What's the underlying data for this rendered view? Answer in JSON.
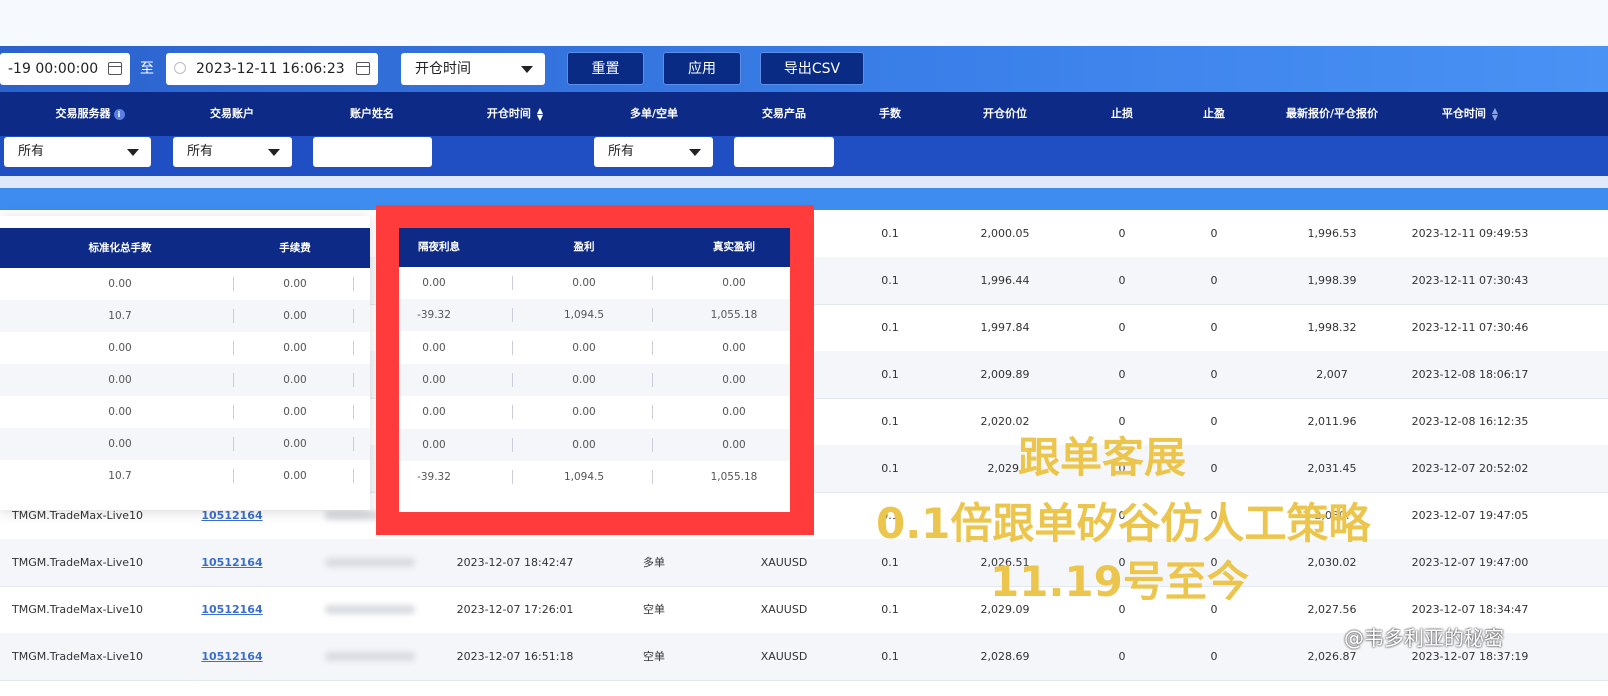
{
  "filters": {
    "start_datetime": "-19 00:00:00",
    "to_label": "至",
    "end_datetime": "2023-12-11 16:06:23",
    "time_type_select": "开仓时间",
    "reset_button": "重置",
    "apply_button": "应用",
    "export_button": "导出CSV"
  },
  "columns": {
    "server": "交易服务器",
    "account": "交易账户",
    "account_name": "账户姓名",
    "open_time": "开仓时间",
    "direction": "多单/空单",
    "product": "交易产品",
    "lots": "手数",
    "open_price": "开仓价位",
    "stop_loss": "止损",
    "take_profit": "止盈",
    "latest_price": "最新报价/平仓报价",
    "close_time": "平仓时间"
  },
  "column_filters": {
    "server": "所有",
    "account": "所有",
    "direction": "所有"
  },
  "rows": [
    {
      "server": "",
      "account": "",
      "open_time": "",
      "direction": "",
      "product": "",
      "lots": "0.1",
      "open_price": "2,000.05",
      "sl": "0",
      "tp": "0",
      "latest": "1,996.53",
      "close_time": "2023-12-11 09:49:53"
    },
    {
      "server": "",
      "account": "",
      "open_time": "",
      "direction": "",
      "product": "",
      "lots": "0.1",
      "open_price": "1,996.44",
      "sl": "0",
      "tp": "0",
      "latest": "1,998.39",
      "close_time": "2023-12-11 07:30:43"
    },
    {
      "server": "",
      "account": "",
      "open_time": "",
      "direction": "",
      "product": "",
      "lots": "0.1",
      "open_price": "1,997.84",
      "sl": "0",
      "tp": "0",
      "latest": "1,998.32",
      "close_time": "2023-12-11 07:30:46"
    },
    {
      "server": "",
      "account": "",
      "open_time": "",
      "direction": "",
      "product": "",
      "lots": "0.1",
      "open_price": "2,009.89",
      "sl": "0",
      "tp": "0",
      "latest": "2,007",
      "close_time": "2023-12-08 18:06:17"
    },
    {
      "server": "",
      "account": "",
      "open_time": "",
      "direction": "",
      "product": "",
      "lots": "0.1",
      "open_price": "2,020.02",
      "sl": "0",
      "tp": "0",
      "latest": "2,011.96",
      "close_time": "2023-12-08 16:12:35"
    },
    {
      "server": "",
      "account": "",
      "open_time": "",
      "direction": "",
      "product": "",
      "lots": "0.1",
      "open_price": "2,029.",
      "sl": "0",
      "tp": "0",
      "latest": "2,031.45",
      "close_time": "2023-12-07 20:52:02"
    },
    {
      "server": "TMGM.TradeMax-Live10",
      "account": "10512164",
      "open_time": "",
      "direction": "",
      "product": "",
      "lots": "0.1",
      "open_price": "",
      "sl": "0",
      "tp": "0",
      "latest": "2,030.",
      "close_time": "2023-12-07 19:47:05"
    },
    {
      "server": "TMGM.TradeMax-Live10",
      "account": "10512164",
      "open_time": "2023-12-07 18:42:47",
      "direction": "多单",
      "product": "XAUUSD",
      "lots": "0.1",
      "open_price": "2,026.51",
      "sl": "0",
      "tp": "0",
      "latest": "2,030.02",
      "close_time": "2023-12-07 19:47:00"
    },
    {
      "server": "TMGM.TradeMax-Live10",
      "account": "10512164",
      "open_time": "2023-12-07 17:26:01",
      "direction": "空单",
      "product": "XAUUSD",
      "lots": "0.1",
      "open_price": "2,029.09",
      "sl": "0",
      "tp": "0",
      "latest": "2,027.56",
      "close_time": "2023-12-07 18:34:47"
    },
    {
      "server": "TMGM.TradeMax-Live10",
      "account": "10512164",
      "open_time": "2023-12-07 16:51:18",
      "direction": "空单",
      "product": "XAUUSD",
      "lots": "0.1",
      "open_price": "2,028.69",
      "sl": "0",
      "tp": "0",
      "latest": "2,026.87",
      "close_time": "2023-12-07 18:37:19"
    }
  ],
  "summary_left": {
    "headers": [
      "标准化总手数",
      "手续费"
    ],
    "rows": [
      [
        "0.00",
        "0.00"
      ],
      [
        "10.7",
        "0.00"
      ],
      [
        "0.00",
        "0.00"
      ],
      [
        "0.00",
        "0.00"
      ],
      [
        "0.00",
        "0.00"
      ],
      [
        "0.00",
        "0.00"
      ],
      [
        "10.7",
        "0.00"
      ]
    ]
  },
  "summary_mid": {
    "headers": [
      "隔夜利息",
      "盈利",
      "真实盈利"
    ],
    "rows": [
      [
        "0.00",
        "0.00",
        "0.00"
      ],
      [
        "-39.32",
        "1,094.5",
        "1,055.18"
      ],
      [
        "0.00",
        "0.00",
        "0.00"
      ],
      [
        "0.00",
        "0.00",
        "0.00"
      ],
      [
        "0.00",
        "0.00",
        "0.00"
      ],
      [
        "0.00",
        "0.00",
        "0.00"
      ],
      [
        "-39.32",
        "1,094.5",
        "1,055.18"
      ]
    ]
  },
  "overlay": {
    "line1": "跟单客展",
    "line2": "0.1倍跟单矽谷仿人工策略",
    "line3": "11.19号至今",
    "watermark": "@韦多利亚的秘密"
  },
  "colors": {
    "header_navy": "#0d2a86",
    "filter_blue": "#3b80ea",
    "highlight_red": "#ff3b3b",
    "overlay_gold": "#ecc54c"
  }
}
